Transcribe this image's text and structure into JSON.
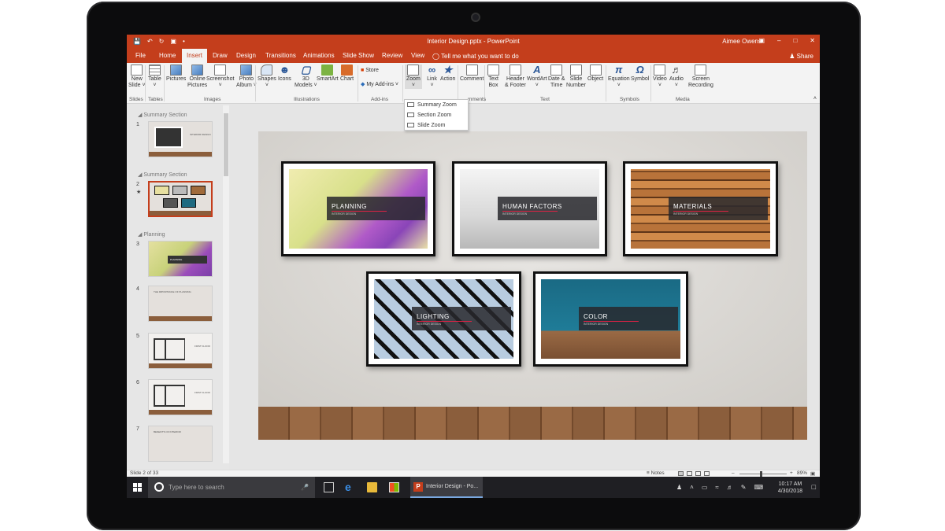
{
  "window": {
    "title": "Interior Design.pptx - PowerPoint",
    "user": "Aimee Owens",
    "share": "Share",
    "tell_me": "Tell me what you want to do"
  },
  "tabs": [
    "File",
    "Home",
    "Insert",
    "Draw",
    "Design",
    "Transitions",
    "Animations",
    "Slide Show",
    "Review",
    "View"
  ],
  "ribbon": {
    "buttons": [
      {
        "l1": "New",
        "l2": "Slide ˅"
      },
      {
        "l1": "Table",
        "l2": "˅"
      },
      {
        "l1": "Pictures",
        "l2": ""
      },
      {
        "l1": "Online",
        "l2": "Pictures"
      },
      {
        "l1": "Screenshot",
        "l2": "˅"
      },
      {
        "l1": "Photo",
        "l2": "Album ˅"
      },
      {
        "l1": "Shapes",
        "l2": "˅"
      },
      {
        "l1": "Icons",
        "l2": ""
      },
      {
        "l1": "3D",
        "l2": "Models ˅"
      },
      {
        "l1": "SmartArt",
        "l2": ""
      },
      {
        "l1": "Chart",
        "l2": ""
      },
      {
        "l1": "Zoom",
        "l2": "˅"
      },
      {
        "l1": "Link",
        "l2": "˅"
      },
      {
        "l1": "Action",
        "l2": ""
      },
      {
        "l1": "Comment",
        "l2": ""
      },
      {
        "l1": "Text",
        "l2": "Box"
      },
      {
        "l1": "Header",
        "l2": "& Footer"
      },
      {
        "l1": "WordArt",
        "l2": "˅"
      },
      {
        "l1": "Date &",
        "l2": "Time"
      },
      {
        "l1": "Slide",
        "l2": "Number"
      },
      {
        "l1": "Object",
        "l2": ""
      },
      {
        "l1": "Equation",
        "l2": "˅"
      },
      {
        "l1": "Symbol",
        "l2": ""
      },
      {
        "l1": "Video",
        "l2": "˅"
      },
      {
        "l1": "Audio",
        "l2": "˅"
      },
      {
        "l1": "Screen",
        "l2": "Recording"
      }
    ],
    "store": "Store",
    "my_addins": "My Add-ins",
    "groups": {
      "slides": "Slides",
      "tables": "Tables",
      "images": "Images",
      "illustrations": "Illustrations",
      "addins": "Add-ins",
      "comments": "mments",
      "text": "Text",
      "symbols": "Symbols",
      "media": "Media"
    }
  },
  "zoom_menu": [
    "Summary Zoom",
    "Section Zoom",
    "Slide Zoom"
  ],
  "thumbnails": {
    "sections": [
      "Summary Section",
      "Summary Section",
      "Planning"
    ],
    "slides": [
      "1",
      "2",
      "3",
      "4",
      "5",
      "6",
      "7"
    ],
    "thumb_texts": [
      "INTERIOR DESIGN",
      "PLANNING",
      "THE IMPORTANCE OF PLANNING",
      "FIRST FLOOR",
      "FIRST FLOOR",
      "BENEFITS OF INTERIOR"
    ]
  },
  "slide_frames": [
    {
      "title": "PLANNING",
      "sub": "INTERIOR DESIGN"
    },
    {
      "title": "HUMAN FACTORS",
      "sub": "INTERIOR DESIGN"
    },
    {
      "title": "MATERIALS",
      "sub": "INTERIOR DESIGN"
    },
    {
      "title": "LIGHTING",
      "sub": "INTERIOR DESIGN"
    },
    {
      "title": "COLOR",
      "sub": "INTERIOR DESIGN"
    }
  ],
  "status": {
    "slide": "Slide 2 of 33",
    "notes": "Notes",
    "zoom": "89%"
  },
  "taskbar": {
    "search": "Type here to search",
    "app": "Interior Design - Po...",
    "time": "10:17 AM",
    "date": "4/30/2018"
  }
}
